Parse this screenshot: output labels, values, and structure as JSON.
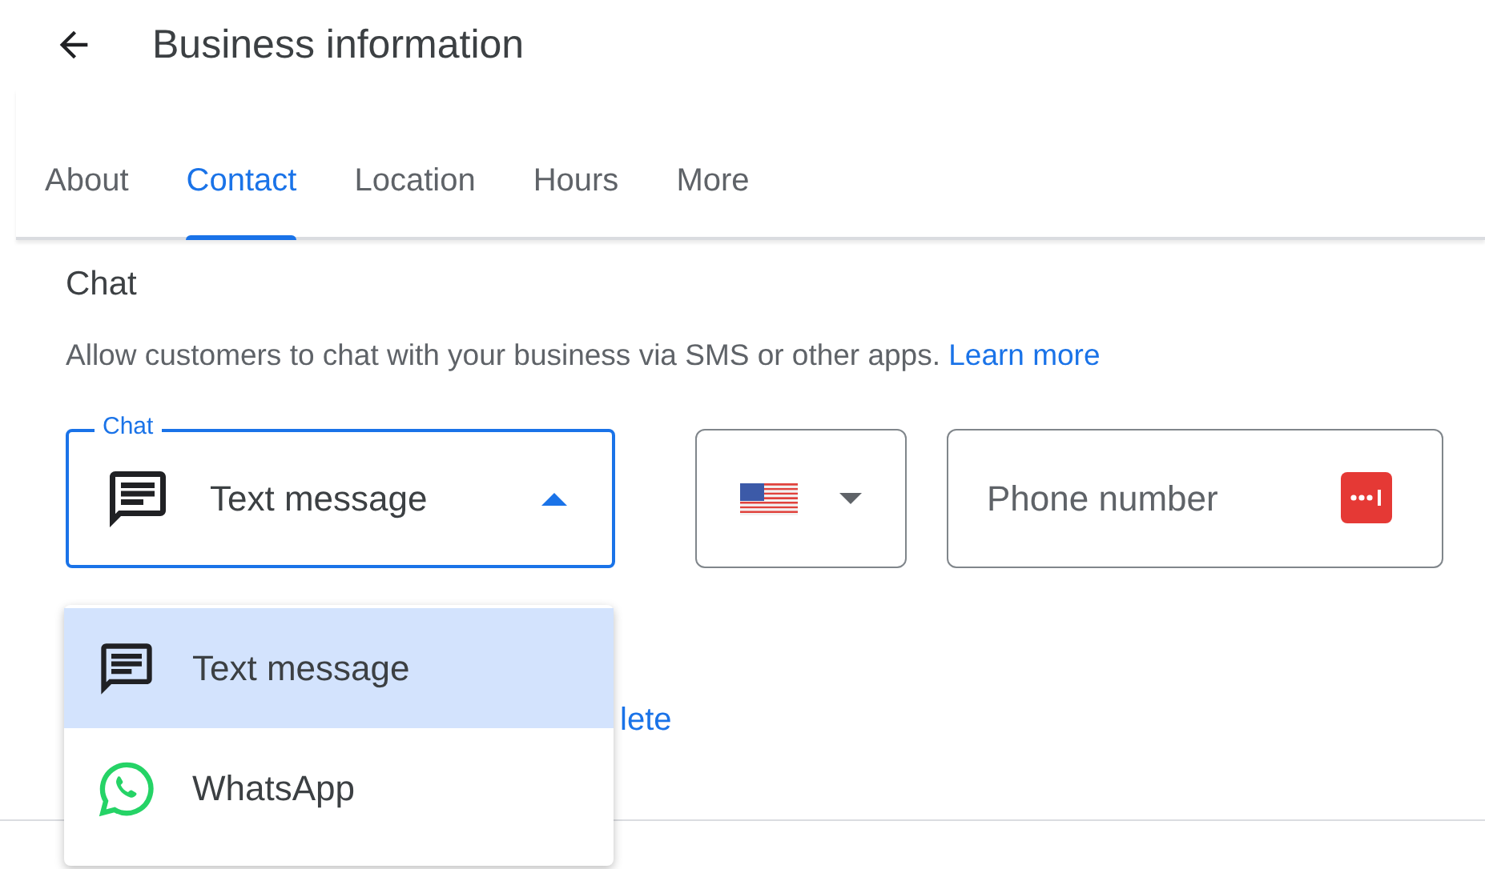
{
  "header": {
    "title": "Business information"
  },
  "tabs": [
    {
      "label": "About",
      "selected": false
    },
    {
      "label": "Contact",
      "selected": true
    },
    {
      "label": "Location",
      "selected": false
    },
    {
      "label": "Hours",
      "selected": false
    },
    {
      "label": "More",
      "selected": false
    }
  ],
  "section": {
    "title": "Chat",
    "description": "Allow customers to chat with your business via SMS or other apps.",
    "link": "Learn more"
  },
  "chat_select": {
    "label": "Chat",
    "value": "Text message",
    "expanded": true
  },
  "phone": {
    "placeholder": "Phone number"
  },
  "menu": [
    {
      "label": "Text message",
      "kind": "sms",
      "selected": true
    },
    {
      "label": "WhatsApp",
      "kind": "whatsapp",
      "selected": false
    }
  ],
  "partial_link": "lete"
}
